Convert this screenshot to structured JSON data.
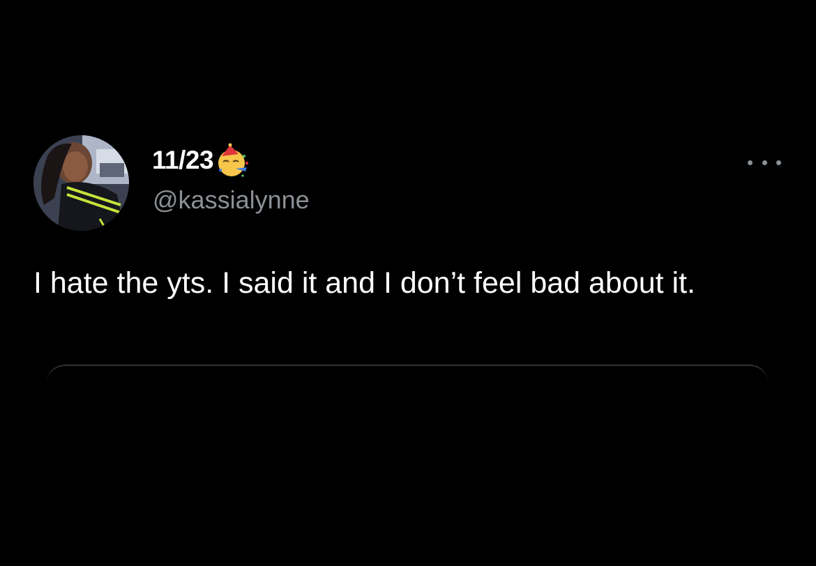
{
  "tweet": {
    "display_name": "11/23",
    "display_name_emoji": "partying-face-emoji",
    "handle": "@kassialynne",
    "text": "I hate the yts. I said it and I don’t feel bad about it.",
    "more_icon": "more-horizontal-icon"
  },
  "colors": {
    "background": "#000000",
    "primary_text": "#ffffff",
    "secondary_text": "#8b9095",
    "divider": "#2f3336"
  }
}
